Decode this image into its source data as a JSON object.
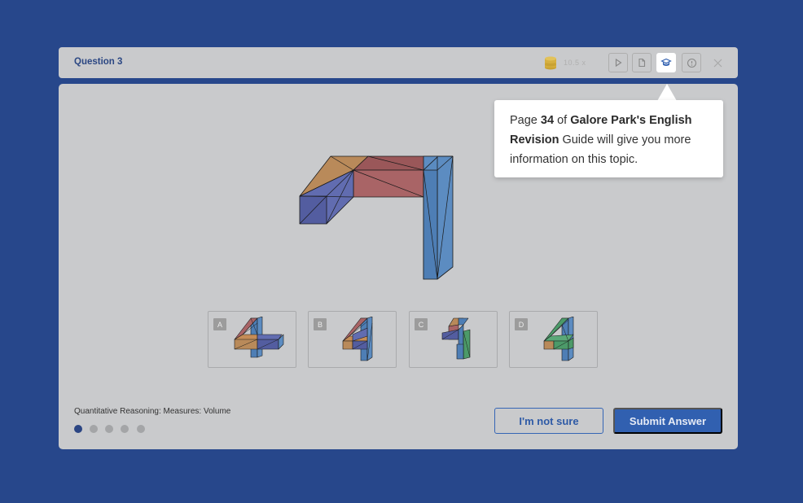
{
  "header": {
    "question_title": "Question 3",
    "coin_label": "10.5 x",
    "buttons": [
      {
        "icon": "play-icon"
      },
      {
        "icon": "document-icon"
      },
      {
        "icon": "graduation-cap-icon",
        "active": true
      },
      {
        "icon": "info-icon"
      },
      {
        "icon": "close-icon"
      }
    ]
  },
  "tooltip": {
    "p1": "Page ",
    "page": "34",
    "p2": " of ",
    "book": "Galore Park's English Revision",
    "p3": " Guide will give you more information on this topic."
  },
  "options": [
    {
      "letter": "A"
    },
    {
      "letter": "B"
    },
    {
      "letter": "C"
    },
    {
      "letter": "D"
    }
  ],
  "footer": {
    "topic": "Quantitative Reasoning: Measures: Volume",
    "progress_total": 5,
    "progress_current": 1,
    "not_sure_label": "I'm not sure",
    "submit_label": "Submit Answer"
  },
  "colors": {
    "background": "#27478b",
    "panel": "#c9cacc",
    "primary": "#3160b0",
    "blue_face": "#4e7eb5",
    "purple_face": "#535da0",
    "red_face": "#a96466",
    "orange_face": "#b98a5a",
    "green_face": "#4c9a69"
  }
}
